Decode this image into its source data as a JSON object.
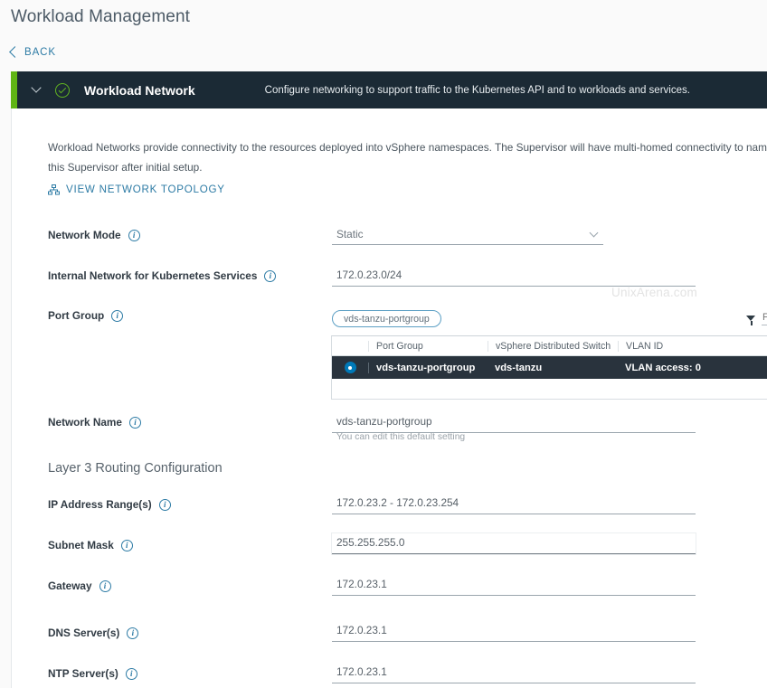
{
  "page": {
    "title": "Workload Management",
    "back_label": "BACK",
    "back_icon": "chevron-left-icon"
  },
  "section": {
    "title": "Workload Network",
    "description": "Configure networking to support traffic to the Kubernetes API and to workloads and services.",
    "collapse_icon": "chevron-down-icon",
    "status_icon": "check-circle-icon",
    "accent_color": "#60b515",
    "header_bg": "#1b2a35"
  },
  "intro": {
    "text": "Workload Networks provide connectivity to the resources deployed into vSphere namespaces. The Supervisor will have multi-homed connectivity to namespaces on this Supervisor after initial setup.",
    "topology_link": "VIEW NETWORK TOPOLOGY",
    "topology_icon": "network-topology-icon"
  },
  "watermark": "UnixArena.com",
  "form": {
    "network_mode": {
      "label": "Network Mode",
      "value": "Static",
      "info_icon": "info-icon",
      "chevron_icon": "chevron-down-icon"
    },
    "internal_network": {
      "label": "Internal Network for Kubernetes Services",
      "value": "172.0.23.0/24",
      "info_icon": "info-icon"
    },
    "port_group": {
      "label": "Port Group",
      "info_icon": "info-icon",
      "chip": "vds-tanzu-portgroup",
      "filter_icon": "filter-icon",
      "filter_value": "",
      "filter_placeholder": "F"
    },
    "network_name": {
      "label": "Network Name",
      "value": "vds-tanzu-portgroup",
      "helper": "You can edit this default setting",
      "info_icon": "info-icon"
    },
    "layer3_title": "Layer 3 Routing Configuration",
    "ip_range": {
      "label": "IP Address Range(s)",
      "value": "172.0.23.2 - 172.0.23.254",
      "info_icon": "info-icon"
    },
    "subnet_mask": {
      "label": "Subnet Mask",
      "value": "255.255.255.0",
      "info_icon": "info-icon"
    },
    "gateway": {
      "label": "Gateway",
      "value": "172.0.23.1",
      "info_icon": "info-icon"
    },
    "dns_servers": {
      "label": "DNS Server(s)",
      "value": "172.0.23.1",
      "info_icon": "info-icon"
    },
    "ntp_servers": {
      "label": "NTP Server(s)",
      "value": "172.0.23.1",
      "info_icon": "info-icon"
    }
  },
  "port_group_table": {
    "columns": [
      "Port Group",
      "vSphere Distributed Switch",
      "VLAN ID"
    ],
    "rows": [
      {
        "selected": true,
        "port_group": "vds-tanzu-portgroup",
        "switch": "vds-tanzu",
        "vlan_id": "VLAN access: 0"
      }
    ],
    "selected_row_bg": "#29333d",
    "radio_color": "#0079b8"
  }
}
